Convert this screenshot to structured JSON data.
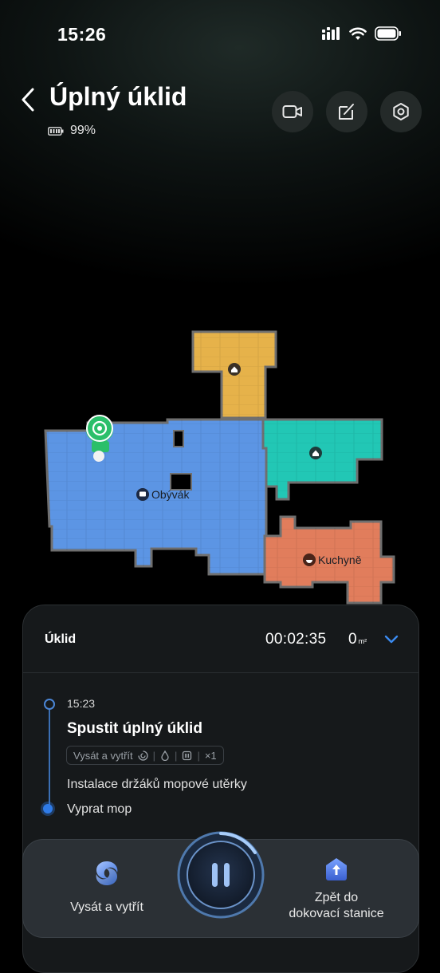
{
  "status_bar": {
    "time": "15:26"
  },
  "header": {
    "title": "Úplný úklid",
    "battery": "99%",
    "buttons": [
      "camera-icon",
      "edit-map-icon",
      "settings-icon"
    ]
  },
  "map": {
    "rooms": [
      {
        "name": "",
        "color": "#e6b24a"
      },
      {
        "name": "Obývák",
        "color": "#5c95e4"
      },
      {
        "name": "",
        "color": "#22c7b5"
      },
      {
        "name": "Kuchyně",
        "color": "#e17d5c"
      }
    ]
  },
  "panel": {
    "title": "Úklid",
    "timer": "00:02:35",
    "area_value": "0",
    "area_unit": "m²",
    "timeline": {
      "time": "15:23",
      "heading": "Spustit úplný úklid",
      "chip_mode": "Vysát a vytřít",
      "chip_count": "×1",
      "steps": [
        "Instalace držáků mopové utěrky",
        "Vyprat mop"
      ]
    }
  },
  "dock": {
    "left_label": "Vysát a vytřít",
    "right_label_line1": "Zpět do",
    "right_label_line2": "dokovací stanice"
  },
  "colors": {
    "accent": "#2f7be8",
    "robot": "#2bbf6a"
  }
}
